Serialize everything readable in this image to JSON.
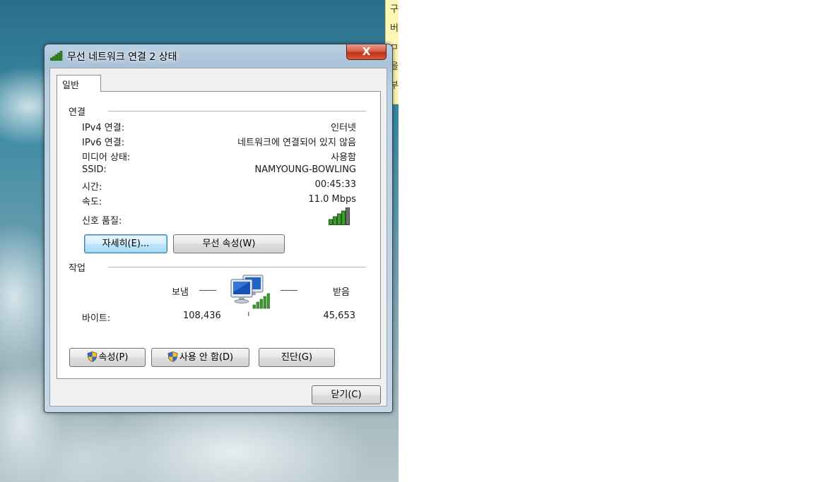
{
  "sticky_note": {
    "lines": [
      "구",
      "버",
      "ㅁ",
      "을",
      "부"
    ]
  },
  "window": {
    "title": "무선 네트워크 연결 2 상태",
    "close_label": "X"
  },
  "tabs": [
    {
      "label": "일반"
    }
  ],
  "connection": {
    "group_label": "연결",
    "rows": [
      {
        "label": "IPv4 연결:",
        "value": "인터넷"
      },
      {
        "label": "IPv6 연결:",
        "value": "네트워크에 연결되어 있지 않음"
      },
      {
        "label": "미디어 상태:",
        "value": "사용함"
      },
      {
        "label": "SSID:",
        "value": "NAMYOUNG-BOWLING"
      },
      {
        "label": "시간:",
        "value": "00:45:33"
      },
      {
        "label": "속도:",
        "value": "11.0 Mbps"
      }
    ],
    "signal_label": "신호 품질:",
    "signal_bars": 5,
    "details_button": "자세히(E)...",
    "wireless_props_button": "무선 속성(W)"
  },
  "activity": {
    "group_label": "작업",
    "sent_label": "보냄",
    "received_label": "받음",
    "bytes_label": "바이트:",
    "bytes_sent": "108,436",
    "bytes_received": "45,653"
  },
  "actions": {
    "properties_button": "속성(P)",
    "disable_button": "사용 안 함(D)",
    "diagnose_button": "진단(G)"
  },
  "footer": {
    "close_button": "닫기(C)"
  },
  "colors": {
    "focus_button": "#bee6fd",
    "signal_green": "#2f8a20",
    "close_red": "#c0321a"
  }
}
